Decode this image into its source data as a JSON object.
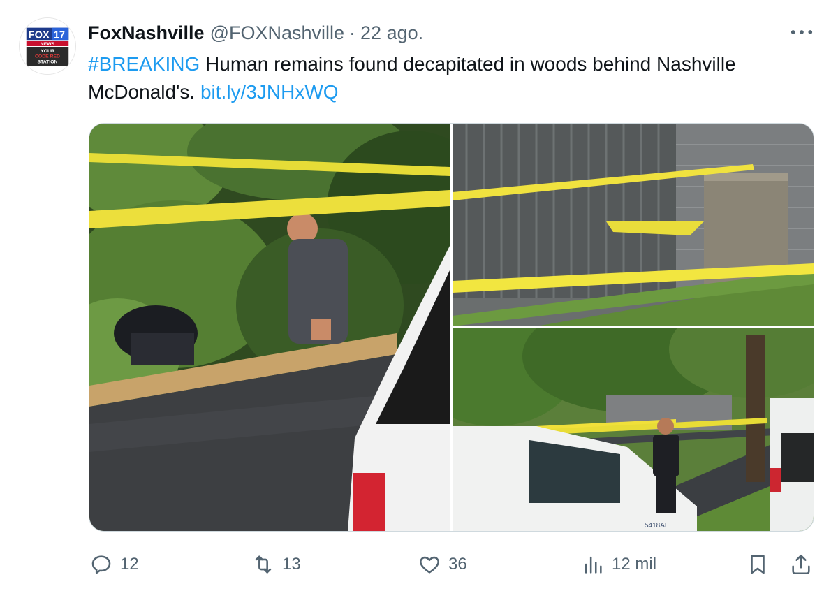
{
  "author": {
    "name": "FoxNashville",
    "handle": "@FOXNashville",
    "separator": "·",
    "time": "22 ago."
  },
  "avatar": {
    "brand_top": "FOX",
    "brand_num": "17",
    "line1": "NEWS",
    "line2": "YOUR",
    "line3": "CODE RED",
    "line4": "STATION",
    "colors": {
      "fox_blue": "#1d3a8a",
      "fox_red": "#c8102e"
    }
  },
  "tweet": {
    "hashtag": "#BREAKING",
    "text": " Human remains found decapitated in woods behind Nashville McDonald's. ",
    "link": "bit.ly/3JNHxWQ"
  },
  "media": {
    "van_text": "5418AE"
  },
  "actions": {
    "reply": {
      "icon": "reply-icon",
      "count": "12"
    },
    "retweet": {
      "icon": "retweet-icon",
      "count": "13"
    },
    "like": {
      "icon": "heart-icon",
      "count": "36"
    },
    "views": {
      "icon": "views-icon",
      "count": "12 mil"
    },
    "bookmark": {
      "icon": "bookmark-icon"
    },
    "share": {
      "icon": "share-icon"
    }
  },
  "colors": {
    "accent": "#1d9bf0",
    "secondary_text": "#536471",
    "primary_text": "#0f1419"
  }
}
